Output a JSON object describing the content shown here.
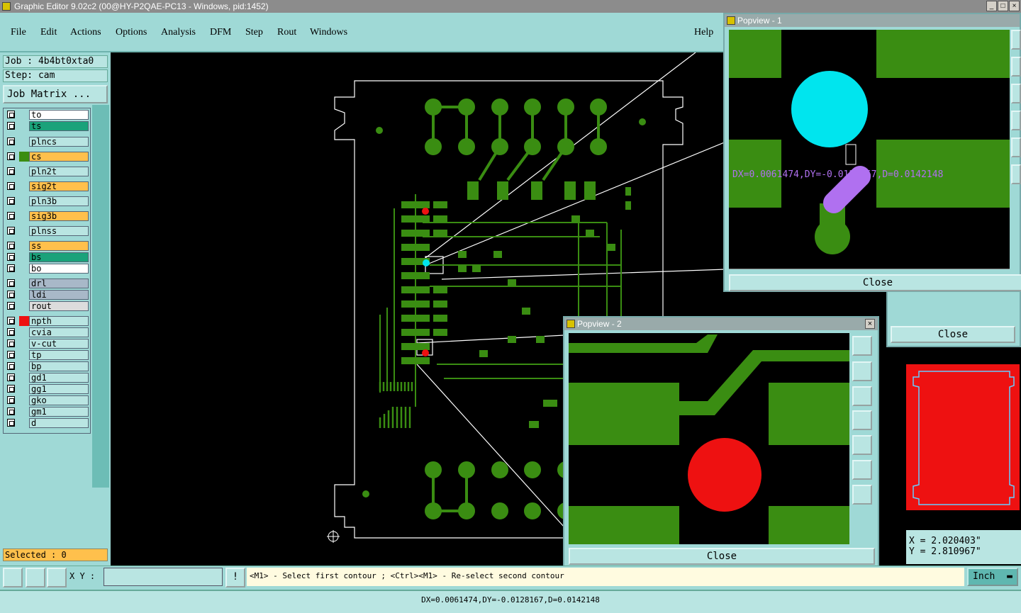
{
  "window": {
    "title": "Graphic Editor 9.02c2 (00@HY-P2QAE-PC13 - Windows, pid:1452)"
  },
  "menu": {
    "items": [
      "File",
      "Edit",
      "Actions",
      "Options",
      "Analysis",
      "DFM",
      "Step",
      "Rout",
      "Windows"
    ],
    "help": "Help"
  },
  "job": {
    "name": "Job : 4b4bt0xta0",
    "step": "Step: cam",
    "matrix_button": "Job Matrix ..."
  },
  "layers": [
    {
      "name": "to",
      "color": "#ffffff",
      "swatch": ""
    },
    {
      "name": "ts",
      "color": "#1aa27a",
      "swatch": ""
    },
    {
      "name": "plncs",
      "color": "#b9e5e2",
      "swatch": ""
    },
    {
      "name": "cs",
      "color": "#ffc04c",
      "swatch": "#3a8d12"
    },
    {
      "name": "pln2t",
      "color": "#b9e5e2",
      "swatch": ""
    },
    {
      "name": "sig2t",
      "color": "#ffc04c",
      "swatch": ""
    },
    {
      "name": "pln3b",
      "color": "#b9e5e2",
      "swatch": ""
    },
    {
      "name": "sig3b",
      "color": "#ffc04c",
      "swatch": ""
    },
    {
      "name": "plnss",
      "color": "#b9e5e2",
      "swatch": ""
    },
    {
      "name": "ss",
      "color": "#ffc04c",
      "swatch": ""
    },
    {
      "name": "bs",
      "color": "#1aa27a",
      "swatch": ""
    },
    {
      "name": "bo",
      "color": "#ffffff",
      "swatch": ""
    },
    {
      "name": "drl",
      "color": "#a8b8c8",
      "swatch": ""
    },
    {
      "name": "ldi",
      "color": "#a8b8c8",
      "swatch": ""
    },
    {
      "name": "rout",
      "color": "#dcdcdc",
      "swatch": ""
    },
    {
      "name": "npth",
      "color": "#b9e5e2",
      "swatch": "#ee1111"
    },
    {
      "name": "cvia",
      "color": "#b9e5e2",
      "swatch": ""
    },
    {
      "name": "v-cut",
      "color": "#b9e5e2",
      "swatch": ""
    },
    {
      "name": "tp",
      "color": "#b9e5e2",
      "swatch": ""
    },
    {
      "name": "bp",
      "color": "#b9e5e2",
      "swatch": ""
    },
    {
      "name": "gd1",
      "color": "#b9e5e2",
      "swatch": ""
    },
    {
      "name": "gg1",
      "color": "#b9e5e2",
      "swatch": ""
    },
    {
      "name": "gko",
      "color": "#b9e5e2",
      "swatch": ""
    },
    {
      "name": "gm1",
      "color": "#b9e5e2",
      "swatch": ""
    },
    {
      "name": "d",
      "color": "#b9e5e2",
      "swatch": ""
    }
  ],
  "selected": "Selected : 0",
  "popview1": {
    "title": "Popview - 1",
    "measure": "DX=0.0061474,DY=-0.0128167,D=0.0142148",
    "close": "Close"
  },
  "popview2": {
    "title": "Popview - 2",
    "close": "Close"
  },
  "bgclose": "Close",
  "coords": {
    "x": "X = 2.020403\"",
    "y": "Y = 2.810967\""
  },
  "bottom": {
    "xy_label": "X Y :",
    "xy_value": "",
    "warn": "!",
    "prompt": "<M1> - Select first contour ; <Ctrl><M1> - Re-select second contour",
    "units": "Inch"
  },
  "status": "DX=0.0061474,DY=-0.0128167,D=0.0142148",
  "colors": {
    "copper": "#3a8d12",
    "cyan": "#00e5ee",
    "red": "#ee1111",
    "violet": "#b070f0",
    "bg": "#9fd9d6"
  }
}
